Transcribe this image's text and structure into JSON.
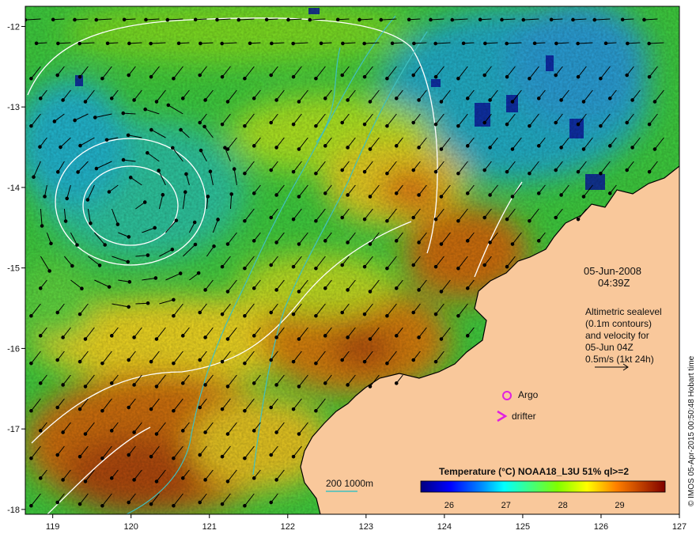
{
  "map": {
    "date": "05-Jun-2008",
    "time": "04:39Z",
    "lon_ticks": [
      "119",
      "120",
      "121",
      "122",
      "123",
      "124",
      "125",
      "126",
      "127"
    ],
    "lat_ticks": [
      "-12",
      "-13",
      "-14",
      "-15",
      "-16",
      "-17",
      "-18"
    ],
    "lon_range": [
      118.65,
      127
    ],
    "lat_range": [
      -18.06,
      -11.75
    ],
    "altimetry_note": [
      "Altimetric sealevel",
      "(0.1m contours)",
      "and velocity for",
      "05-Jun 04Z",
      "0.5m/s (1kt 24h)"
    ],
    "legend": {
      "argo_label": "Argo",
      "drifter_label": "drifter",
      "argo_symbol": "o",
      "drifter_symbol": ">",
      "argo_color": "#e020e0",
      "drifter_color": "#e020e0"
    },
    "bathymetry_label": "200  1000m",
    "colorbar": {
      "title": "Temperature (°C) NOAA18_L3U 51% ql>=2",
      "ticks": [
        "26",
        "27",
        "28",
        "29"
      ],
      "range": [
        25.5,
        29.8
      ],
      "colors": [
        "#00007f",
        "#0000ff",
        "#0080ff",
        "#00ffff",
        "#40ff80",
        "#80ff00",
        "#ffff00",
        "#ff8000",
        "#c04000",
        "#800000"
      ]
    },
    "credit": "© IMOS 05-Apr-2015 00:50:48 Hobart time",
    "colors": {
      "land": "#f9c89b",
      "velocity_arrows": "#000000",
      "sealevel_contours": "#ffffff",
      "bathymetry_contours": "#40c0c0"
    }
  }
}
